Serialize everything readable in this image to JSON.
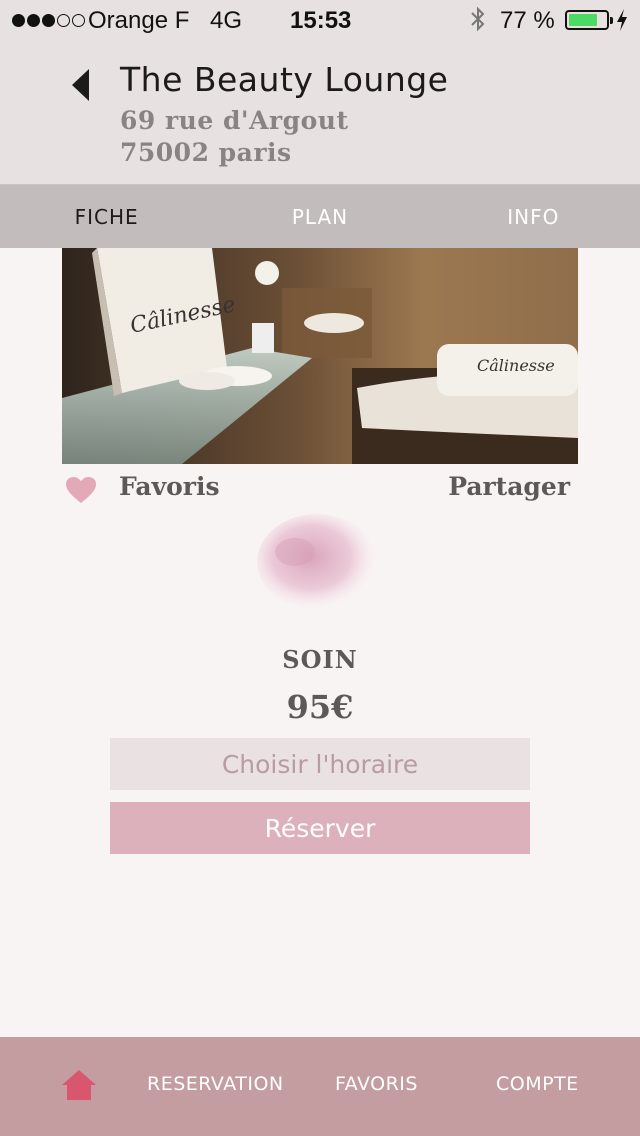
{
  "status_bar": {
    "carrier": "Orange F",
    "network": "4G",
    "time": "15:53",
    "battery_percent": "77 %",
    "battery_level": 0.77,
    "battery_color": "#4cd964"
  },
  "header": {
    "back_icon": "chevron-left-icon",
    "title": "The Beauty Lounge",
    "address_line1": "69 rue d'Argout",
    "address_line2": "75002 paris"
  },
  "tabs": [
    {
      "label": "FICHE",
      "active": true
    },
    {
      "label": "PLAN",
      "active": false
    },
    {
      "label": "INFO",
      "active": false
    }
  ],
  "photo": {
    "book_text": "Câlinesse",
    "towel_text": "Câlinesse"
  },
  "actions": {
    "favorite_label": "Favoris",
    "share_label": "Partager",
    "favorite_icon": "heart-icon",
    "accent_color": "#e3a9b7"
  },
  "service": {
    "icon": "powder-icon",
    "title": "SOIN",
    "price": "95€",
    "choose_time_label": "Choisir l'horaire",
    "book_label": "Réserver"
  },
  "bottom_nav": {
    "home_icon": "home-icon",
    "items": [
      {
        "label": "RESERVATION"
      },
      {
        "label": "FAVORIS"
      },
      {
        "label": "COMPTE"
      }
    ]
  }
}
